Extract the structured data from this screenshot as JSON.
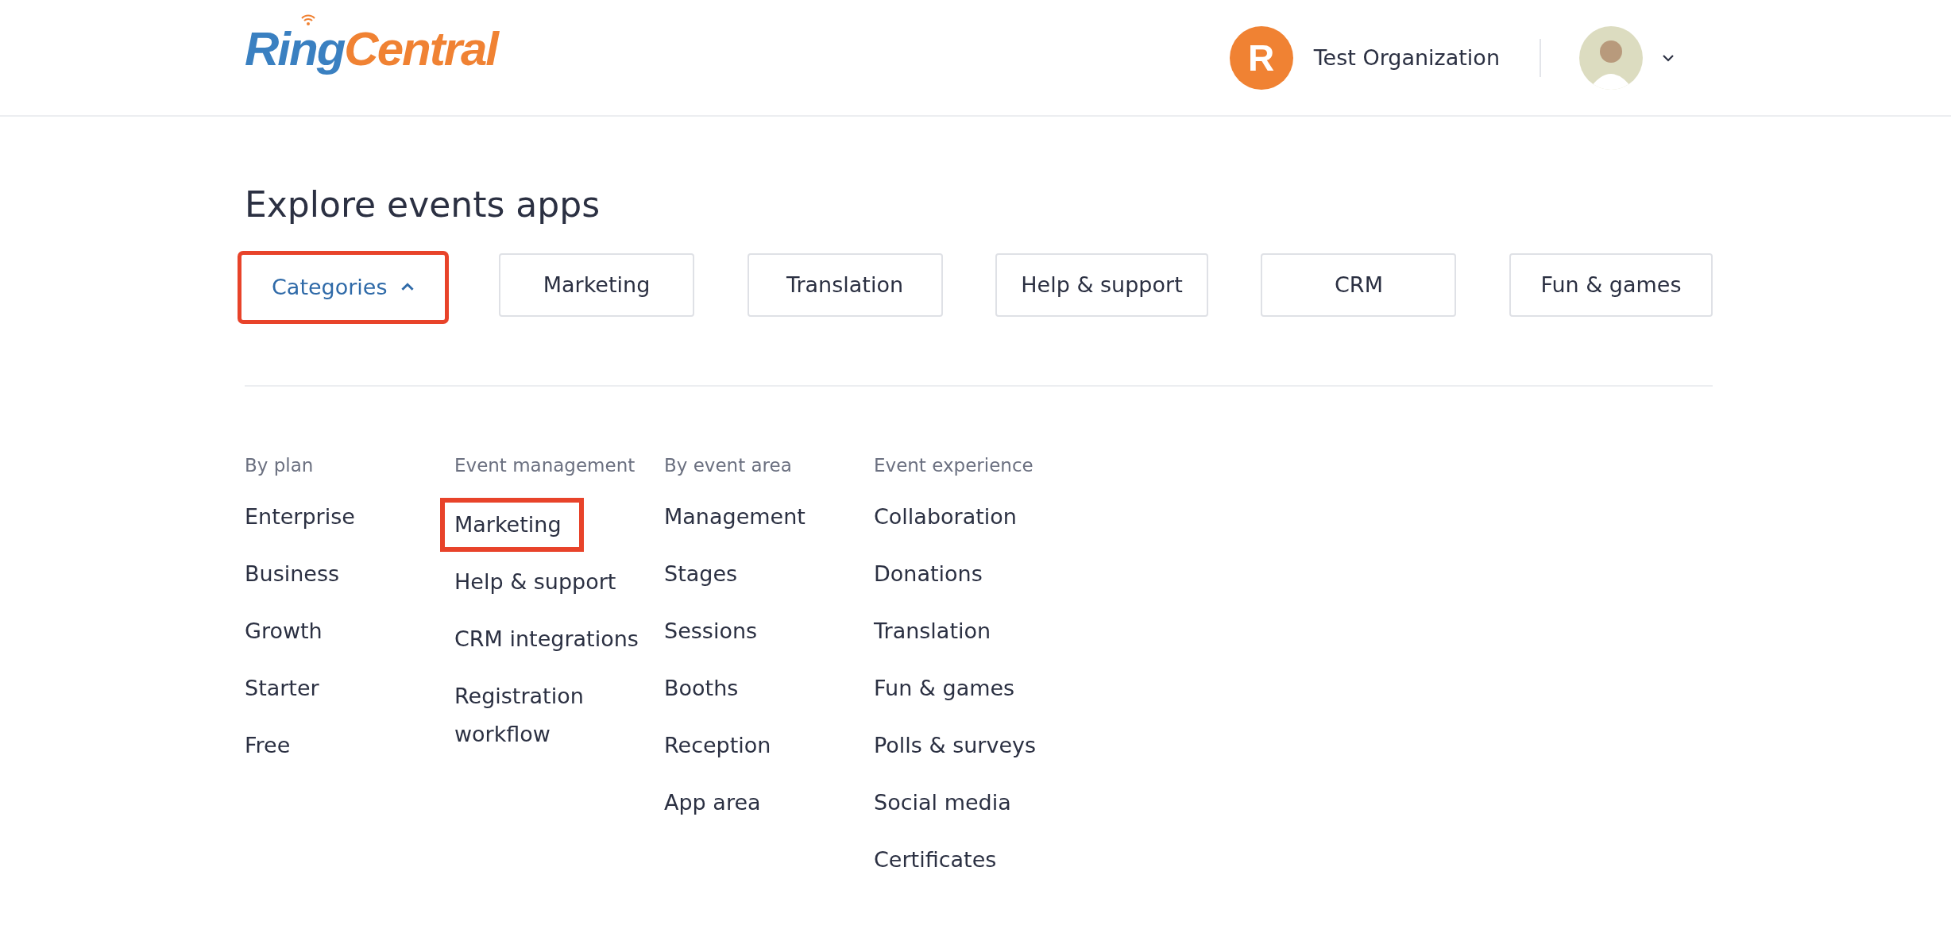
{
  "header": {
    "logo": {
      "part_1": "Ring",
      "part_2": "Central"
    },
    "organization": {
      "logo_letter": "R",
      "name": "Test Organization"
    },
    "user": {
      "menu_expanded": false
    }
  },
  "title": "Explore events apps",
  "filters": [
    {
      "label": "Categories",
      "kind": "dropdown",
      "expanded": true,
      "highlighted": true
    },
    {
      "label": "Marketing",
      "kind": "chip",
      "highlighted": false
    },
    {
      "label": "Translation",
      "kind": "chip",
      "highlighted": false
    },
    {
      "label": "Help & support",
      "kind": "chip",
      "highlighted": false
    },
    {
      "label": "CRM",
      "kind": "chip",
      "highlighted": false
    },
    {
      "label": "Fun & games",
      "kind": "chip",
      "highlighted": false
    }
  ],
  "category_columns": [
    {
      "heading": "By plan",
      "items": [
        {
          "label": "Enterprise",
          "highlighted": false
        },
        {
          "label": "Business",
          "highlighted": false
        },
        {
          "label": "Growth",
          "highlighted": false
        },
        {
          "label": "Starter",
          "highlighted": false
        },
        {
          "label": "Free",
          "highlighted": false
        }
      ]
    },
    {
      "heading": "Event management",
      "items": [
        {
          "label": "Marketing",
          "highlighted": true
        },
        {
          "label": "Help & support",
          "highlighted": false
        },
        {
          "label": "CRM integrations",
          "highlighted": false
        },
        {
          "label": "Registration workflow",
          "highlighted": false
        }
      ]
    },
    {
      "heading": "By event area",
      "items": [
        {
          "label": "Management",
          "highlighted": false
        },
        {
          "label": "Stages",
          "highlighted": false
        },
        {
          "label": "Sessions",
          "highlighted": false
        },
        {
          "label": "Booths",
          "highlighted": false
        },
        {
          "label": "Reception",
          "highlighted": false
        },
        {
          "label": "App area",
          "highlighted": false
        }
      ]
    },
    {
      "heading": "Event experience",
      "items": [
        {
          "label": "Collaboration",
          "highlighted": false
        },
        {
          "label": "Donations",
          "highlighted": false
        },
        {
          "label": "Translation",
          "highlighted": false
        },
        {
          "label": "Fun & games",
          "highlighted": false
        },
        {
          "label": "Polls & surveys",
          "highlighted": false
        },
        {
          "label": "Social media",
          "highlighted": false
        },
        {
          "label": "Certificates",
          "highlighted": false
        }
      ]
    }
  ]
}
